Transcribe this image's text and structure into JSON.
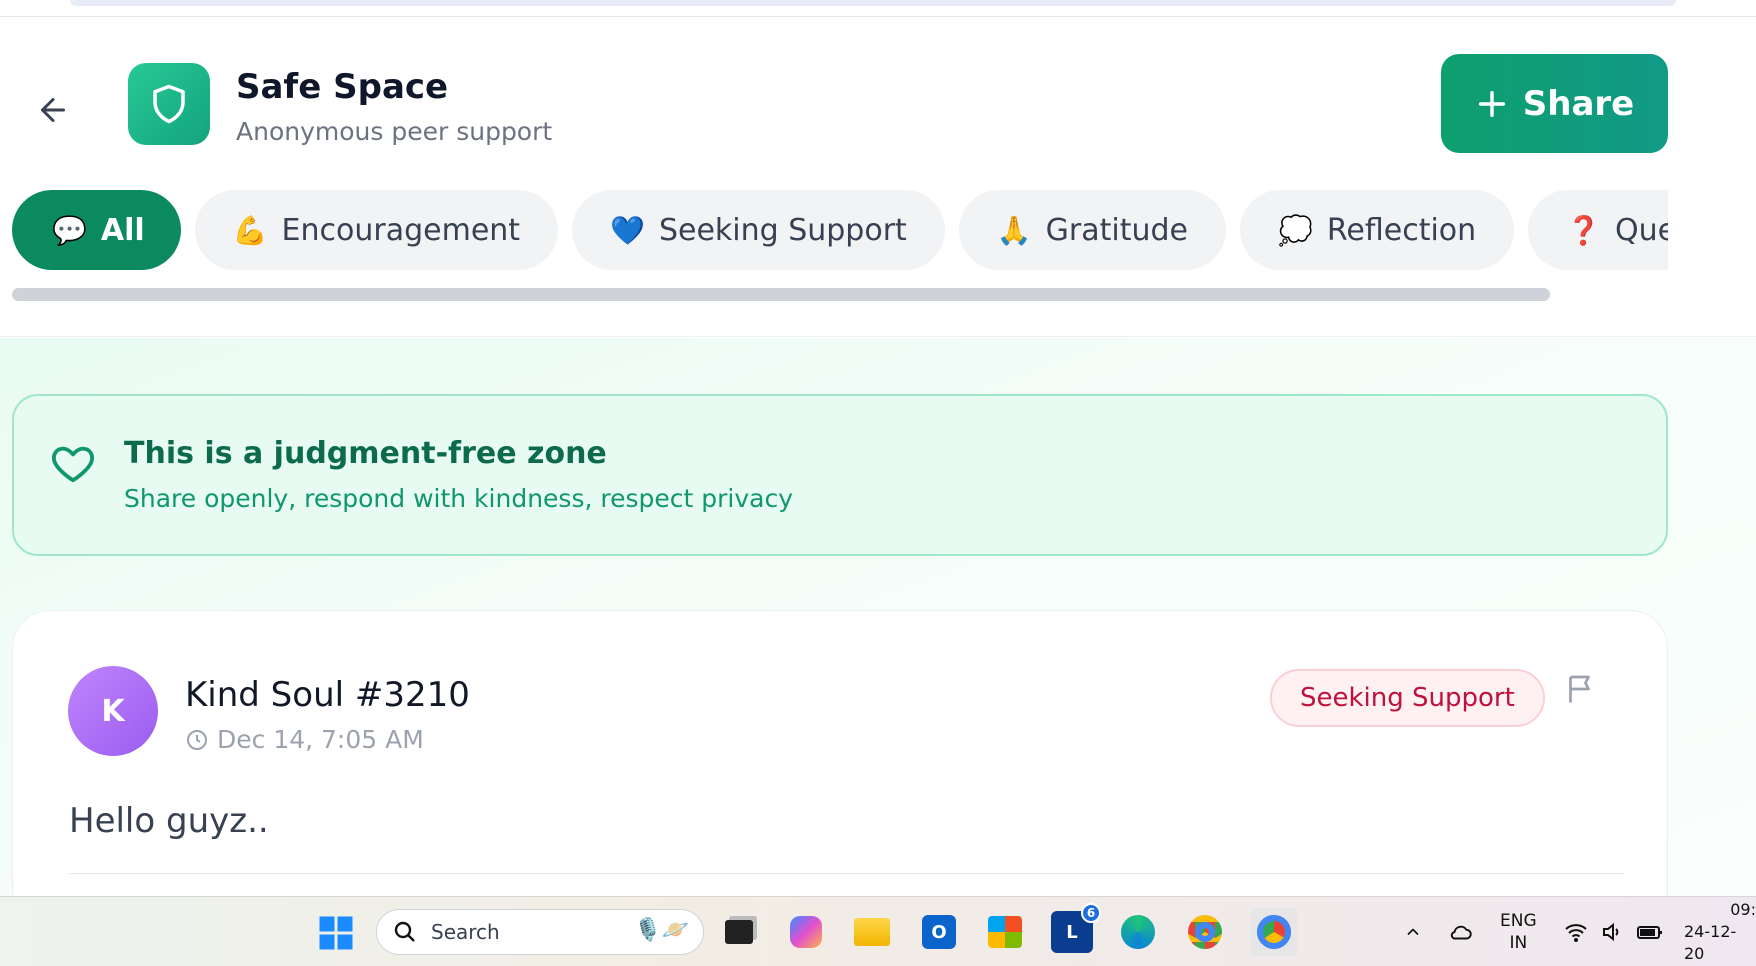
{
  "header": {
    "title": "Safe Space",
    "subtitle": "Anonymous peer support",
    "share_label": "Share"
  },
  "categories": [
    {
      "emoji": "💬",
      "label": "All",
      "active": true
    },
    {
      "emoji": "💪",
      "label": "Encouragement"
    },
    {
      "emoji": "💙",
      "label": "Seeking Support"
    },
    {
      "emoji": "🙏",
      "label": "Gratitude"
    },
    {
      "emoji": "💭",
      "label": "Reflection"
    },
    {
      "emoji": "❓",
      "label": "Que"
    }
  ],
  "banner": {
    "title": "This is a judgment-free zone",
    "text": "Share openly, respond with kindness, respect privacy"
  },
  "post": {
    "avatar_initial": "K",
    "author": "Kind Soul #3210",
    "time": "Dec 14, 7:05 AM",
    "category": "Seeking Support",
    "body": "Hello guyz.."
  },
  "taskbar": {
    "search_placeholder": "Search",
    "lang_line1": "ENG",
    "lang_line2": "IN",
    "linkedin_badge": "6",
    "linkedin_letter": "L",
    "outlook_letter": "O",
    "clock_time": "09:",
    "clock_date": "24-12-20"
  },
  "colors": {
    "brand_green": "#0c8a5f",
    "banner_bg": "#e8fbf3",
    "badge_red": "#be123c",
    "avatar_purple": "#a86bf5"
  }
}
